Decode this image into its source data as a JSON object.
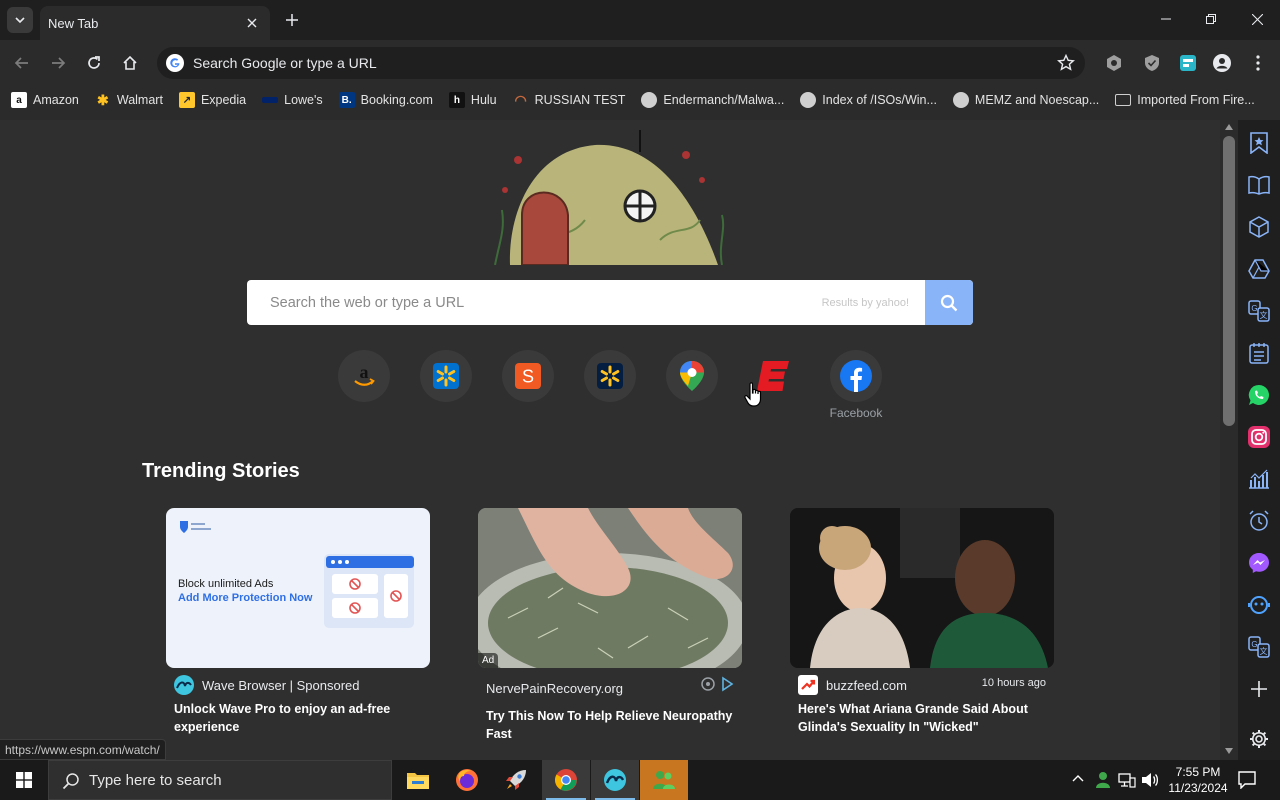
{
  "browser": {
    "tab_title": "New Tab",
    "omnibox_text": "Search Google or type a URL",
    "bookmarks": [
      {
        "label": "Amazon",
        "icon": "amazon-icon"
      },
      {
        "label": "Walmart",
        "icon": "walmart-icon"
      },
      {
        "label": "Expedia",
        "icon": "expedia-icon"
      },
      {
        "label": "Lowe's",
        "icon": "lowes-icon"
      },
      {
        "label": "Booking.com",
        "icon": "booking-icon"
      },
      {
        "label": "Hulu",
        "icon": "hulu-icon"
      },
      {
        "label": "RUSSIAN TEST",
        "icon": "russian-test-icon"
      },
      {
        "label": "Endermanch/Malwa...",
        "icon": "globe-icon"
      },
      {
        "label": "Index of /ISOs/Win...",
        "icon": "globe-icon"
      },
      {
        "label": "MEMZ and Noescap...",
        "icon": "globe-icon"
      },
      {
        "label": "Imported From Fire...",
        "icon": "folder-icon"
      }
    ],
    "status_url": "https://www.espn.com/watch/"
  },
  "newtab": {
    "search_placeholder": "Search the web or type a URL",
    "results_by": "Results by yahoo!",
    "shortcuts": [
      {
        "name": "amazon",
        "icon": "amazon-icon"
      },
      {
        "name": "walmart",
        "icon": "walmart-icon"
      },
      {
        "name": "swagbucks",
        "icon": "s-icon"
      },
      {
        "name": "walmart-2",
        "icon": "walmart-icon"
      },
      {
        "name": "google-maps",
        "icon": "maps-pin-icon"
      },
      {
        "name": "espn",
        "icon": "espn-icon"
      },
      {
        "name": "facebook",
        "icon": "facebook-icon"
      }
    ],
    "facebook_label": "Facebook",
    "trending_title": "Trending Stories",
    "cards": [
      {
        "source": "Wave Browser | Sponsored",
        "headline": "Unlock Wave Pro to enjoy an ad-free experience",
        "ad_line1": "Block unlimited Ads",
        "ad_line2": "Add More Protection Now"
      },
      {
        "source": "NervePainRecovery.org",
        "badge": "Ad",
        "headline": "Try This Now To Help Relieve Neuropathy Fast"
      },
      {
        "source": "buzzfeed.com",
        "time": "10 hours ago",
        "headline": "Here's What Ariana Grande Said About Glinda's Sexuality In \"Wicked\""
      }
    ]
  },
  "taskbar": {
    "search_placeholder": "Type here to search",
    "time": "7:55 PM",
    "date": "11/23/2024"
  },
  "colors": {
    "accent_blue": "#8ab4f8",
    "page_bg": "#2f2f2f",
    "frame_bg": "#1f1f1f"
  }
}
